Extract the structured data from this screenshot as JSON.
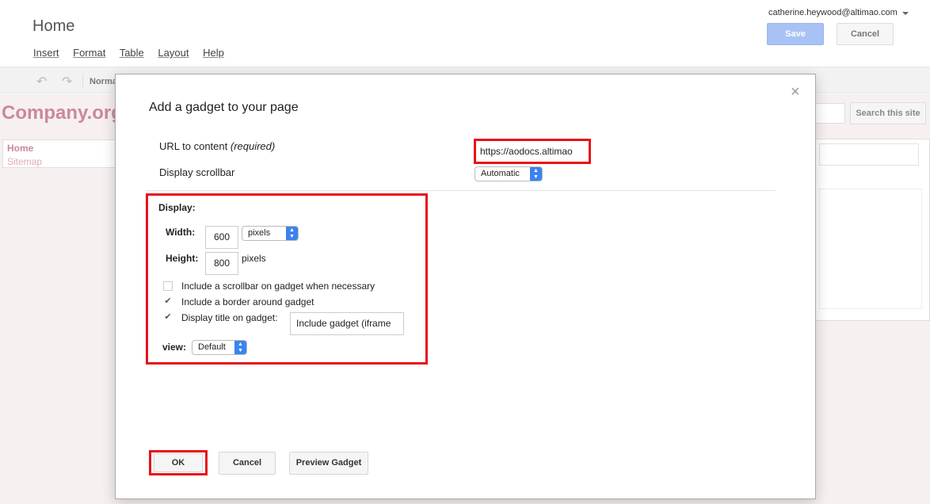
{
  "page": {
    "title": "Home",
    "menu": [
      "Insert",
      "Format",
      "Table",
      "Layout",
      "Help"
    ],
    "user_email": "catherine.heywood@altimao.com",
    "save_label": "Save",
    "cancel_label": "Cancel",
    "toolbar_style_label": "Normal"
  },
  "site": {
    "logo": "Company.org",
    "nav": [
      "Home",
      "Sitemap"
    ],
    "search_button": "Search this site"
  },
  "dialog": {
    "title": "Add a gadget to your page",
    "close_glyph": "×",
    "url_label": "URL to content",
    "url_required": "(required)",
    "url_value": "https://aodocs.altimao",
    "scrollbar_label": "Display scrollbar",
    "scrollbar_value": "Automatic",
    "display": {
      "label": "Display:",
      "width_label": "Width:",
      "width_value": "600",
      "width_unit": "pixels",
      "height_label": "Height:",
      "height_value": "800",
      "height_unit": "pixels",
      "checkbox_scrollbar": "Include a scrollbar on gadget when necessary",
      "checkbox_scrollbar_checked": false,
      "checkbox_border": "Include a border around gadget",
      "checkbox_border_checked": true,
      "checkbox_title": "Display title on gadget:",
      "checkbox_title_checked": true,
      "title_value": "Include gadget (iframe",
      "view_label": "view:",
      "view_value": "Default"
    },
    "ok_label": "OK",
    "cancel_label": "Cancel",
    "preview_label": "Preview Gadget"
  },
  "colors": {
    "highlight_red": "#e8111b",
    "accent_blue": "#3b83f0",
    "site_pink": "#c98a9a"
  }
}
